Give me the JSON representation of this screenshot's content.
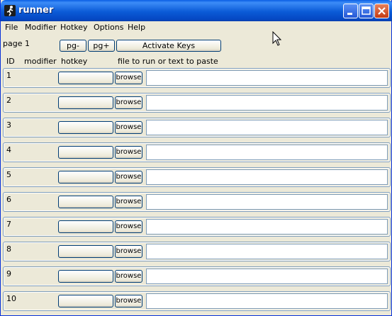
{
  "window": {
    "title": "runner"
  },
  "menu": [
    "File",
    "Modifier",
    "Hotkey",
    "Options",
    "Help"
  ],
  "toolbar": {
    "page_label": "page 1",
    "pg_prev": "pg-",
    "pg_next": "pg+",
    "activate": "Activate Keys"
  },
  "headers": {
    "id": "ID",
    "modifier": "modifier",
    "hotkey": "hotkey",
    "file": "file to run or text to paste"
  },
  "rows": [
    {
      "id": "1",
      "hotkey": "",
      "browse": "browse",
      "path": ""
    },
    {
      "id": "2",
      "hotkey": "",
      "browse": "browse",
      "path": ""
    },
    {
      "id": "3",
      "hotkey": "",
      "browse": "browse",
      "path": ""
    },
    {
      "id": "4",
      "hotkey": "",
      "browse": "browse",
      "path": ""
    },
    {
      "id": "5",
      "hotkey": "",
      "browse": "browse",
      "path": ""
    },
    {
      "id": "6",
      "hotkey": "",
      "browse": "browse",
      "path": ""
    },
    {
      "id": "7",
      "hotkey": "",
      "browse": "browse",
      "path": ""
    },
    {
      "id": "8",
      "hotkey": "",
      "browse": "browse",
      "path": ""
    },
    {
      "id": "9",
      "hotkey": "",
      "browse": "browse",
      "path": ""
    },
    {
      "id": "10",
      "hotkey": "",
      "browse": "browse",
      "path": ""
    }
  ],
  "colors": {
    "titlebar": "#0a5ee3",
    "face": "#ece9d8",
    "border": "#7f9db9",
    "close": "#c43b13"
  },
  "icons": {
    "app": "runner-app-icon",
    "minimize": "minimize-icon",
    "maximize": "maximize-icon",
    "close": "close-icon",
    "cursor": "mouse-pointer-icon"
  }
}
